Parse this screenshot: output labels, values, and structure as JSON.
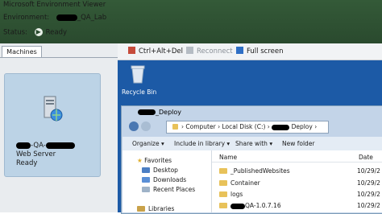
{
  "app": {
    "title": "Microsoft Environment Viewer"
  },
  "environment": {
    "label": "Environment:",
    "name_suffix": "_QA_Lab"
  },
  "status": {
    "label": "Status:",
    "value": "Ready"
  },
  "tabs": [
    {
      "label": "Machines"
    }
  ],
  "machine": {
    "name_prefix": "",
    "name_fragment": "-QA-",
    "role": "Web Server",
    "status": "Ready"
  },
  "toolbar": {
    "ctrl_alt_del": "Ctrl+Alt+Del",
    "reconnect": "Reconnect",
    "full_screen": "Full screen"
  },
  "desktop": {
    "recycle_bin": "Recycle Bin"
  },
  "explorer": {
    "window_title_suffix": "_Deploy",
    "address": [
      "Computer",
      "Local Disk (C:)",
      "Deploy"
    ],
    "toolbar": [
      "Organize",
      "Include in library",
      "Share with",
      "New folder"
    ],
    "columns": {
      "name": "Name",
      "date": "Date"
    },
    "nav": [
      {
        "label": "Favorites"
      },
      {
        "label": "Desktop"
      },
      {
        "label": "Downloads"
      },
      {
        "label": "Recent Places"
      },
      {
        "label": "Libraries"
      }
    ],
    "files": [
      {
        "name": "_PublishedWebsites",
        "date": "10/29/2"
      },
      {
        "name": "Container",
        "date": "10/29/2"
      },
      {
        "name": "logs",
        "date": "10/29/2"
      },
      {
        "name": "QA-1.0.7.16",
        "date": "10/29/2"
      }
    ]
  },
  "colors": {
    "header_green": "#2f5234",
    "desktop_blue": "#1c5aa6",
    "card_blue": "#bcd3e6"
  }
}
